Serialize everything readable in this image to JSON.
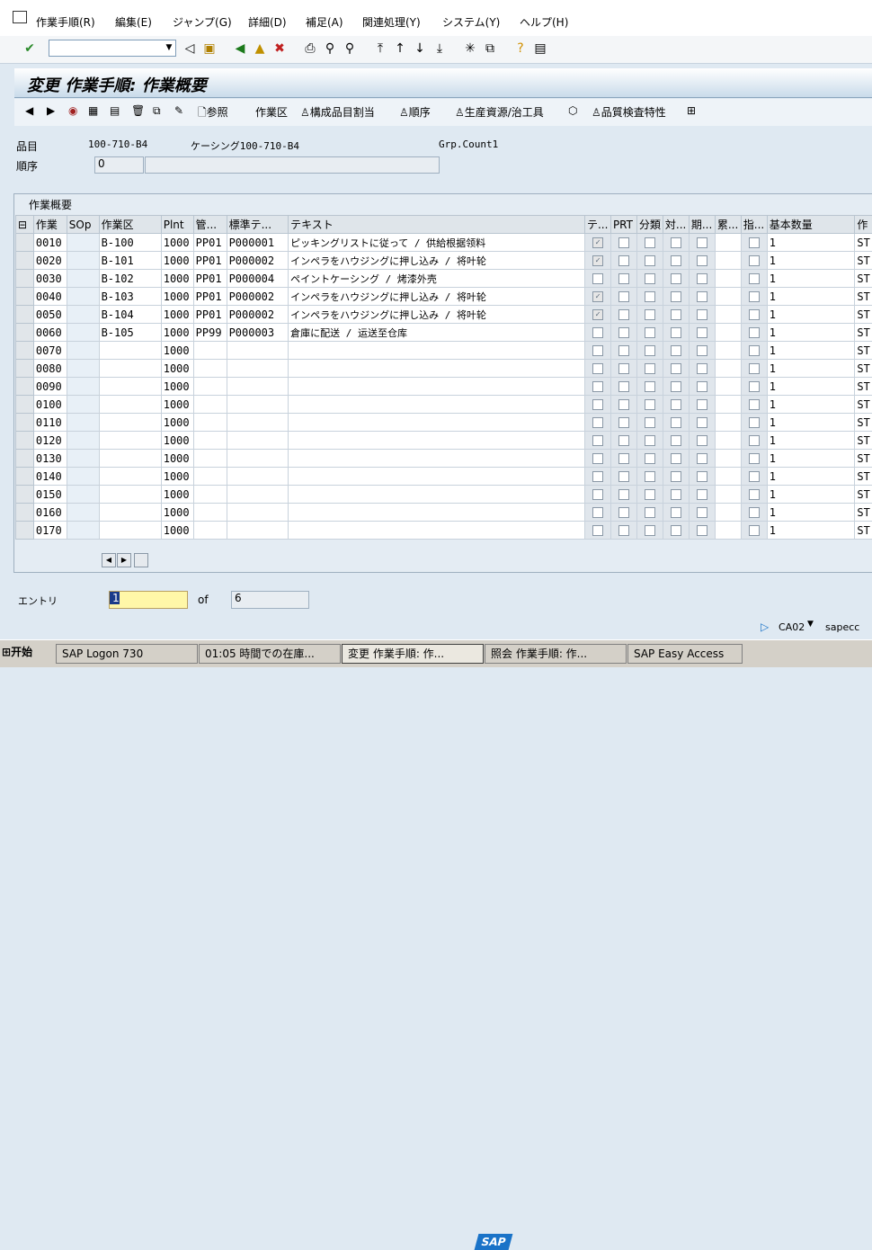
{
  "menu": {
    "items": [
      "作業手順(R)",
      "編集(E)",
      "ジャンプ(G)",
      "詳細(D)",
      "補足(A)",
      "関連処理(Y)",
      "システム(Y)",
      "ヘルプ(H)"
    ]
  },
  "screen_title": "変更 作業手順: 作業概要",
  "app_toolbar": {
    "ref_label": "参照",
    "work_area_label": "作業区",
    "component_alloc_label": "構成品目割当",
    "sequence_label": "順序",
    "prt_label": "生産資源/治工具",
    "inspection_label": "品質検査特性"
  },
  "header": {
    "material_label": "品目",
    "material_value": "100-710-B4",
    "material_desc": "ケーシング100-710-B4",
    "group_counter": "Grp.Count1",
    "sequence_label": "順序",
    "sequence_value": "0"
  },
  "table": {
    "title": "作業概要",
    "columns": [
      "作業",
      "SOp",
      "作業区",
      "Plnt",
      "管...",
      "標準テ...",
      "テキスト",
      "テ...",
      "PRT",
      "分類",
      "対...",
      "期...",
      "累...",
      "指...",
      "基本数量",
      "作"
    ],
    "rows": [
      {
        "op": "0010",
        "sop": "",
        "wc": "B-100",
        "plnt": "1000",
        "ctrl": "PP01",
        "std": "P000001",
        "text": "ピッキングリストに従って / 供給根据领料",
        "t": true
      },
      {
        "op": "0020",
        "sop": "",
        "wc": "B-101",
        "plnt": "1000",
        "ctrl": "PP01",
        "std": "P000002",
        "text": "インペラをハウジングに押し込み / 将叶轮",
        "t": true
      },
      {
        "op": "0030",
        "sop": "",
        "wc": "B-102",
        "plnt": "1000",
        "ctrl": "PP01",
        "std": "P000004",
        "text": "ペイントケーシング / 烤漆外壳",
        "t": false
      },
      {
        "op": "0040",
        "sop": "",
        "wc": "B-103",
        "plnt": "1000",
        "ctrl": "PP01",
        "std": "P000002",
        "text": "インペラをハウジングに押し込み / 将叶轮",
        "t": true
      },
      {
        "op": "0050",
        "sop": "",
        "wc": "B-104",
        "plnt": "1000",
        "ctrl": "PP01",
        "std": "P000002",
        "text": "インペラをハウジングに押し込み / 将叶轮",
        "t": true
      },
      {
        "op": "0060",
        "sop": "",
        "wc": "B-105",
        "plnt": "1000",
        "ctrl": "PP99",
        "std": "P000003",
        "text": "倉庫に配送 / 运送至仓库",
        "t": false
      },
      {
        "op": "0070",
        "sop": "",
        "wc": "",
        "plnt": "1000",
        "ctrl": "",
        "std": "",
        "text": "",
        "t": false
      },
      {
        "op": "0080",
        "sop": "",
        "wc": "",
        "plnt": "1000",
        "ctrl": "",
        "std": "",
        "text": "",
        "t": false
      },
      {
        "op": "0090",
        "sop": "",
        "wc": "",
        "plnt": "1000",
        "ctrl": "",
        "std": "",
        "text": "",
        "t": false
      },
      {
        "op": "0100",
        "sop": "",
        "wc": "",
        "plnt": "1000",
        "ctrl": "",
        "std": "",
        "text": "",
        "t": false
      },
      {
        "op": "0110",
        "sop": "",
        "wc": "",
        "plnt": "1000",
        "ctrl": "",
        "std": "",
        "text": "",
        "t": false
      },
      {
        "op": "0120",
        "sop": "",
        "wc": "",
        "plnt": "1000",
        "ctrl": "",
        "std": "",
        "text": "",
        "t": false
      },
      {
        "op": "0130",
        "sop": "",
        "wc": "",
        "plnt": "1000",
        "ctrl": "",
        "std": "",
        "text": "",
        "t": false
      },
      {
        "op": "0140",
        "sop": "",
        "wc": "",
        "plnt": "1000",
        "ctrl": "",
        "std": "",
        "text": "",
        "t": false
      },
      {
        "op": "0150",
        "sop": "",
        "wc": "",
        "plnt": "1000",
        "ctrl": "",
        "std": "",
        "text": "",
        "t": false
      },
      {
        "op": "0160",
        "sop": "",
        "wc": "",
        "plnt": "1000",
        "ctrl": "",
        "std": "",
        "text": "",
        "t": false
      },
      {
        "op": "0170",
        "sop": "",
        "wc": "",
        "plnt": "1000",
        "ctrl": "",
        "std": "",
        "text": "",
        "t": false
      }
    ],
    "base_qty": "1",
    "last_col_prefix": "ST"
  },
  "entry": {
    "label": "エントリ",
    "value": "1",
    "of_label": "of",
    "total": "6"
  },
  "status": {
    "system": "CA02",
    "server": "sapecc"
  },
  "taskbar": {
    "start": "开始",
    "tasks": [
      "SAP Logon 730",
      "01:05 時間での在庫...",
      "変更 作業手順: 作...",
      "照会 作業手順: 作...",
      "SAP Easy Access"
    ]
  },
  "colors": {
    "accent": "#1a73c8",
    "entry_bg": "#fff7a8",
    "panel": "#e4ecf3"
  }
}
